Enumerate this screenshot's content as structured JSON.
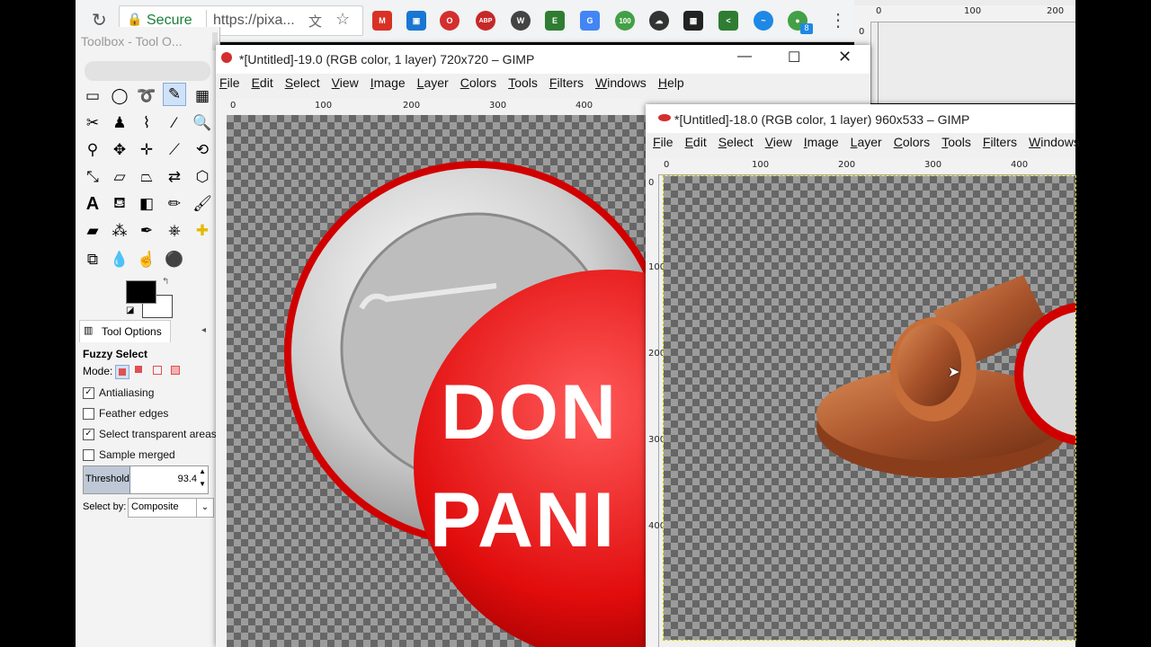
{
  "browser": {
    "security_label": "Secure",
    "url": "https://pixa...",
    "extensions": [
      "gmail-icon",
      "flip-icon",
      "opera-icon",
      "adblock-icon",
      "wordpress-icon",
      "evernote-icon",
      "translate-icon",
      "score-icon",
      "cloud-icon",
      "film-icon",
      "share-icon",
      "pulse-icon",
      "chat-icon"
    ],
    "badge_count": "8",
    "colors": {
      "bar": "#f1f3f4"
    }
  },
  "toolbox": {
    "title": "Toolbox - Tool O...",
    "tool_options_tab": "Tool Options",
    "tool_name": "Fuzzy Select",
    "mode_label": "Mode:",
    "options": [
      {
        "label": "Antialiasing",
        "checked": true
      },
      {
        "label": "Feather edges",
        "checked": false
      },
      {
        "label": "Select transparent areas",
        "checked": true
      },
      {
        "label": "Sample merged",
        "checked": false
      }
    ],
    "threshold_label": "Threshold",
    "threshold_value": "93.4",
    "threshold_fraction": 0.37,
    "select_by_label": "Select by:",
    "select_by_value": "Composite",
    "foreground_color": "#000000",
    "background_color": "#ffffff"
  },
  "window1": {
    "title": "*[Untitled]-19.0 (RGB color, 1 layer) 720x720 – GIMP",
    "menus": [
      "File",
      "Edit",
      "Select",
      "View",
      "Image",
      "Layer",
      "Colors",
      "Tools",
      "Filters",
      "Windows",
      "Help"
    ],
    "ruler_ticks": [
      "0",
      "100",
      "200",
      "300",
      "400"
    ],
    "button_text_line1": "DON",
    "button_text_line2": "PANI"
  },
  "window2": {
    "title": "*[Untitled]-18.0 (RGB color, 1 layer) 960x533 – GIMP",
    "menus": [
      "File",
      "Edit",
      "Select",
      "View",
      "Image",
      "Layer",
      "Colors",
      "Tools",
      "Filters",
      "Windows"
    ],
    "ruler_ticks": [
      "0",
      "100",
      "200",
      "300",
      "400"
    ],
    "vruler_ticks": [
      "0",
      "100",
      "200",
      "300",
      "400"
    ]
  },
  "bg_window": {
    "ruler_ticks": [
      "0",
      "100",
      "200"
    ],
    "vruler_ticks": [
      "0"
    ]
  }
}
